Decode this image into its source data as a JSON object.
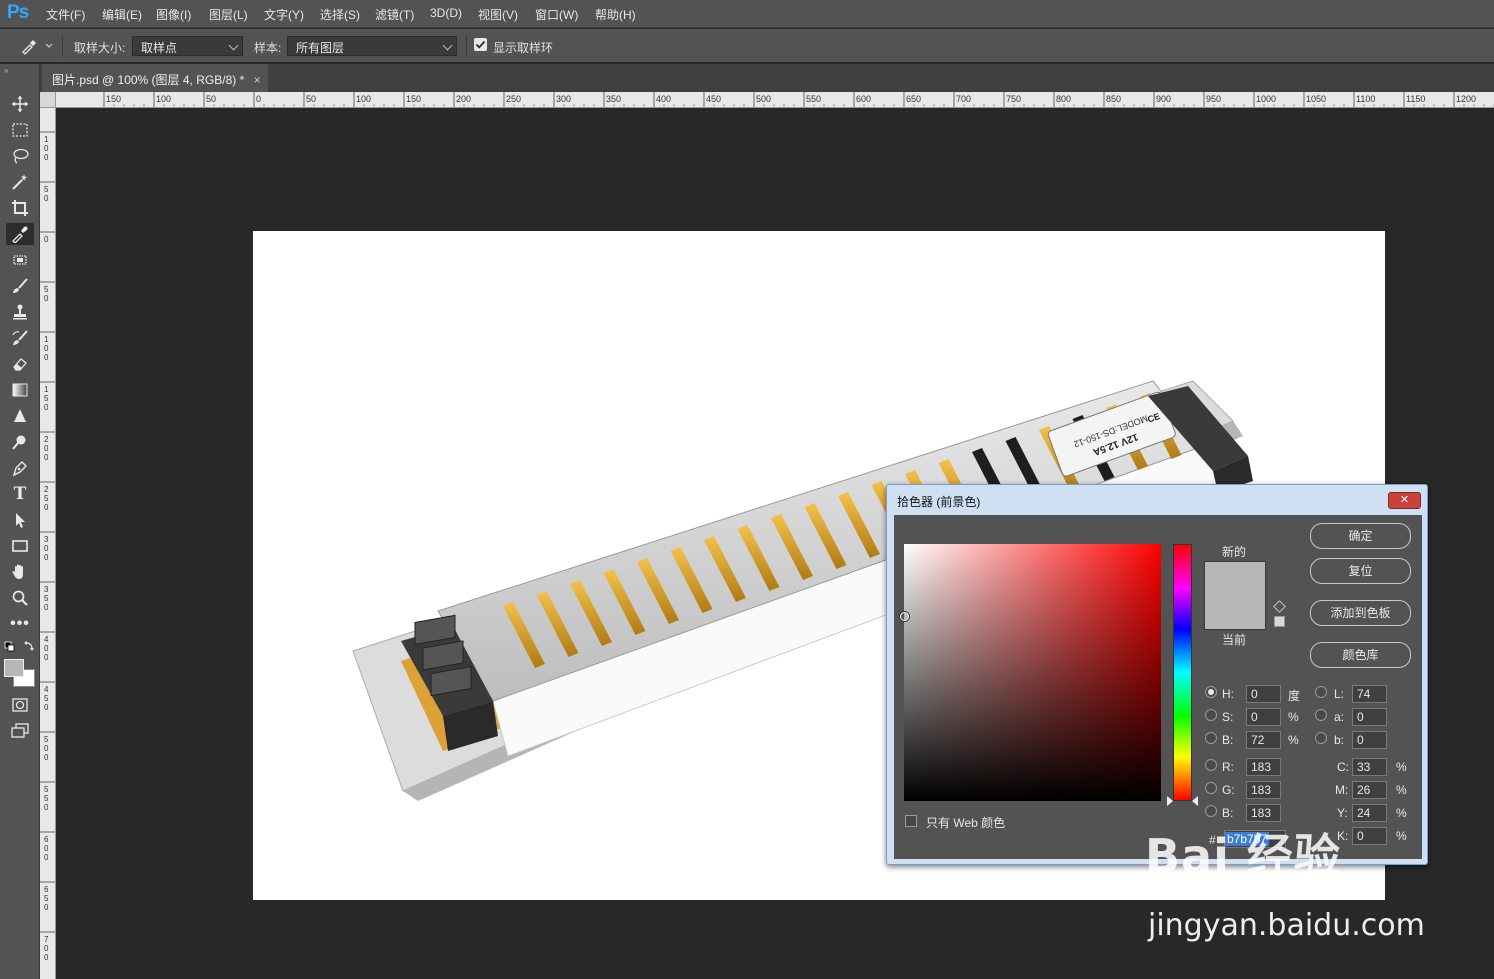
{
  "app": {
    "logo": "Ps"
  },
  "menu": [
    "文件(F)",
    "编辑(E)",
    "图像(I)",
    "图层(L)",
    "文字(Y)",
    "选择(S)",
    "滤镜(T)",
    "3D(D)",
    "视图(V)",
    "窗口(W)",
    "帮助(H)"
  ],
  "options": {
    "sample_size_label": "取样大小:",
    "sample_size_value": "取样点",
    "sample_label": "样本:",
    "sample_value": "所有图层",
    "show_ring_label": "显示取样环",
    "show_ring_checked": true
  },
  "document": {
    "tab_title": "图片.psd @ 100% (图层 4, RGB/8) *",
    "close": "×"
  },
  "ruler": {
    "h_labels": [
      "150",
      "100",
      "50",
      "0",
      "50",
      "100",
      "150",
      "200",
      "250",
      "300",
      "350",
      "400",
      "450",
      "500",
      "550",
      "600",
      "650",
      "700",
      "750",
      "800",
      "850",
      "900",
      "950",
      "1000",
      "1050",
      "1100",
      "1150",
      "1200"
    ],
    "v_labels": [
      "1\n0\n0",
      "5\n0",
      "0",
      "5\n0",
      "1\n0\n0",
      "1\n5\n0",
      "2\n0\n0",
      "2\n5\n0",
      "3\n0\n0",
      "3\n5\n0",
      "4\n0\n0",
      "4\n5\n0",
      "5\n0\n0",
      "5\n5\n0",
      "6\n0\n0",
      "6\n5\n0",
      "7\n0\n0"
    ]
  },
  "tools": [
    "move",
    "marquee",
    "lasso",
    "magic-wand",
    "crop",
    "eyedropper",
    "patch",
    "brush",
    "stamp",
    "history-brush",
    "eraser",
    "gradient",
    "blur",
    "dodge",
    "pen",
    "type",
    "path-select",
    "rectangle",
    "hand",
    "zoom",
    "more",
    "colors",
    "quick-mask",
    "screen-mode"
  ],
  "picker": {
    "title": "拾色器 (前景色)",
    "close": "✕",
    "new_label": "新的",
    "current_label": "当前",
    "current_color": "#b7b7b7",
    "buttons": {
      "ok": "确定",
      "reset": "复位",
      "add_swatch": "添加到色板",
      "libraries": "颜色库"
    },
    "hsb": {
      "h_label": "H:",
      "h": "0",
      "h_unit": "度",
      "s_label": "S:",
      "s": "0",
      "s_unit": "%",
      "b_label": "B:",
      "b": "72",
      "b_unit": "%"
    },
    "rgb": {
      "r_label": "R:",
      "r": "183",
      "g_label": "G:",
      "g": "183",
      "b_label": "B:",
      "b": "183"
    },
    "lab": {
      "l_label": "L:",
      "l": "74",
      "a_label": "a:",
      "a": "0",
      "b_label": "b:",
      "b": "0"
    },
    "cmyk": {
      "c_label": "C:",
      "c": "33",
      "m_label": "M:",
      "m": "26",
      "y_label": "Y:",
      "y": "24",
      "k_label": "K:",
      "k": "0",
      "unit": "%"
    },
    "web_only_label": "只有 Web 颜色",
    "hex_label": "#",
    "hex": "b7b7b7"
  },
  "product": {
    "label_model": "MODEL:DS-150-12",
    "label_rating": "12V 12.5A",
    "label_ce": "CE"
  },
  "watermark": {
    "logo": "Bai 经验",
    "url": "jingyan.baidu.com"
  }
}
